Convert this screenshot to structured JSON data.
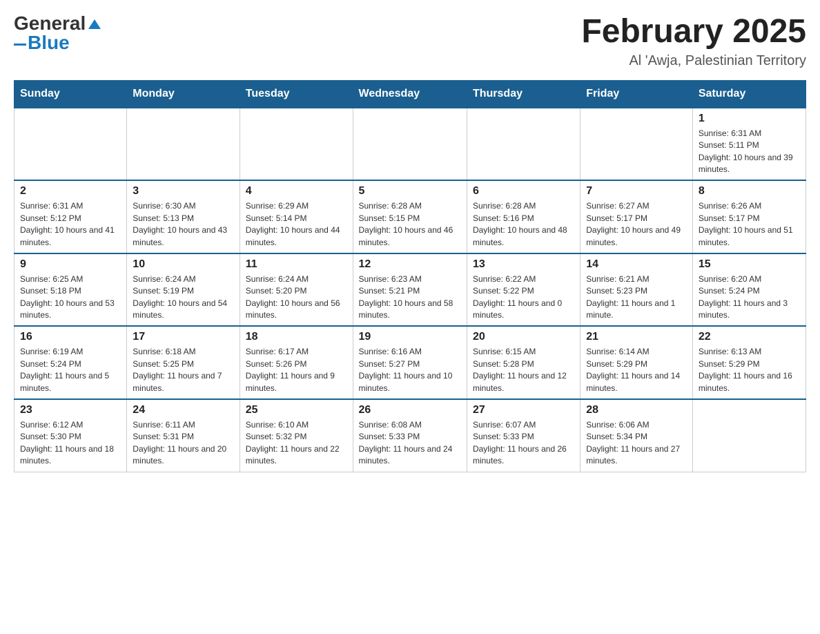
{
  "header": {
    "logo_general": "General",
    "logo_blue": "Blue",
    "title": "February 2025",
    "location": "Al 'Awja, Palestinian Territory"
  },
  "days_of_week": [
    "Sunday",
    "Monday",
    "Tuesday",
    "Wednesday",
    "Thursday",
    "Friday",
    "Saturday"
  ],
  "weeks": [
    [
      {
        "day": "",
        "info": ""
      },
      {
        "day": "",
        "info": ""
      },
      {
        "day": "",
        "info": ""
      },
      {
        "day": "",
        "info": ""
      },
      {
        "day": "",
        "info": ""
      },
      {
        "day": "",
        "info": ""
      },
      {
        "day": "1",
        "info": "Sunrise: 6:31 AM\nSunset: 5:11 PM\nDaylight: 10 hours and 39 minutes."
      }
    ],
    [
      {
        "day": "2",
        "info": "Sunrise: 6:31 AM\nSunset: 5:12 PM\nDaylight: 10 hours and 41 minutes."
      },
      {
        "day": "3",
        "info": "Sunrise: 6:30 AM\nSunset: 5:13 PM\nDaylight: 10 hours and 43 minutes."
      },
      {
        "day": "4",
        "info": "Sunrise: 6:29 AM\nSunset: 5:14 PM\nDaylight: 10 hours and 44 minutes."
      },
      {
        "day": "5",
        "info": "Sunrise: 6:28 AM\nSunset: 5:15 PM\nDaylight: 10 hours and 46 minutes."
      },
      {
        "day": "6",
        "info": "Sunrise: 6:28 AM\nSunset: 5:16 PM\nDaylight: 10 hours and 48 minutes."
      },
      {
        "day": "7",
        "info": "Sunrise: 6:27 AM\nSunset: 5:17 PM\nDaylight: 10 hours and 49 minutes."
      },
      {
        "day": "8",
        "info": "Sunrise: 6:26 AM\nSunset: 5:17 PM\nDaylight: 10 hours and 51 minutes."
      }
    ],
    [
      {
        "day": "9",
        "info": "Sunrise: 6:25 AM\nSunset: 5:18 PM\nDaylight: 10 hours and 53 minutes."
      },
      {
        "day": "10",
        "info": "Sunrise: 6:24 AM\nSunset: 5:19 PM\nDaylight: 10 hours and 54 minutes."
      },
      {
        "day": "11",
        "info": "Sunrise: 6:24 AM\nSunset: 5:20 PM\nDaylight: 10 hours and 56 minutes."
      },
      {
        "day": "12",
        "info": "Sunrise: 6:23 AM\nSunset: 5:21 PM\nDaylight: 10 hours and 58 minutes."
      },
      {
        "day": "13",
        "info": "Sunrise: 6:22 AM\nSunset: 5:22 PM\nDaylight: 11 hours and 0 minutes."
      },
      {
        "day": "14",
        "info": "Sunrise: 6:21 AM\nSunset: 5:23 PM\nDaylight: 11 hours and 1 minute."
      },
      {
        "day": "15",
        "info": "Sunrise: 6:20 AM\nSunset: 5:24 PM\nDaylight: 11 hours and 3 minutes."
      }
    ],
    [
      {
        "day": "16",
        "info": "Sunrise: 6:19 AM\nSunset: 5:24 PM\nDaylight: 11 hours and 5 minutes."
      },
      {
        "day": "17",
        "info": "Sunrise: 6:18 AM\nSunset: 5:25 PM\nDaylight: 11 hours and 7 minutes."
      },
      {
        "day": "18",
        "info": "Sunrise: 6:17 AM\nSunset: 5:26 PM\nDaylight: 11 hours and 9 minutes."
      },
      {
        "day": "19",
        "info": "Sunrise: 6:16 AM\nSunset: 5:27 PM\nDaylight: 11 hours and 10 minutes."
      },
      {
        "day": "20",
        "info": "Sunrise: 6:15 AM\nSunset: 5:28 PM\nDaylight: 11 hours and 12 minutes."
      },
      {
        "day": "21",
        "info": "Sunrise: 6:14 AM\nSunset: 5:29 PM\nDaylight: 11 hours and 14 minutes."
      },
      {
        "day": "22",
        "info": "Sunrise: 6:13 AM\nSunset: 5:29 PM\nDaylight: 11 hours and 16 minutes."
      }
    ],
    [
      {
        "day": "23",
        "info": "Sunrise: 6:12 AM\nSunset: 5:30 PM\nDaylight: 11 hours and 18 minutes."
      },
      {
        "day": "24",
        "info": "Sunrise: 6:11 AM\nSunset: 5:31 PM\nDaylight: 11 hours and 20 minutes."
      },
      {
        "day": "25",
        "info": "Sunrise: 6:10 AM\nSunset: 5:32 PM\nDaylight: 11 hours and 22 minutes."
      },
      {
        "day": "26",
        "info": "Sunrise: 6:08 AM\nSunset: 5:33 PM\nDaylight: 11 hours and 24 minutes."
      },
      {
        "day": "27",
        "info": "Sunrise: 6:07 AM\nSunset: 5:33 PM\nDaylight: 11 hours and 26 minutes."
      },
      {
        "day": "28",
        "info": "Sunrise: 6:06 AM\nSunset: 5:34 PM\nDaylight: 11 hours and 27 minutes."
      },
      {
        "day": "",
        "info": ""
      }
    ]
  ]
}
